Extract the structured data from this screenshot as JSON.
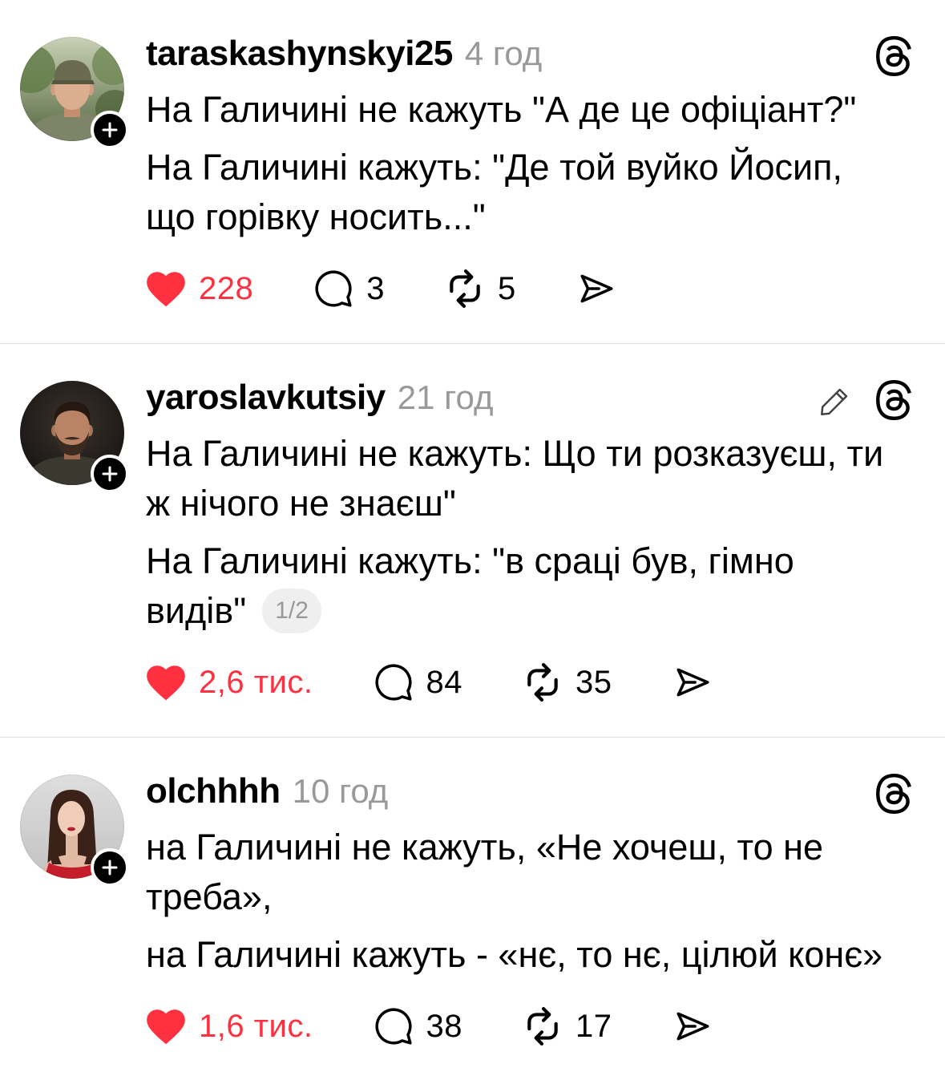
{
  "theme": {
    "accent": "#ff3040",
    "text": "#000000",
    "muted": "#999999",
    "divider": "#e1e1e1",
    "pill": "#efefef"
  },
  "icons": {
    "like": "heart-icon",
    "reply": "comment-icon",
    "repost": "repost-icon",
    "share": "send-icon",
    "app_logo": "threads-logo-icon",
    "edit": "pencil-icon",
    "follow": "plus-icon"
  },
  "posts": [
    {
      "username": "taraskashynskyi25",
      "time": "4 год",
      "text": [
        [
          "На Галичині не кажуть \"А де це офіціант?\""
        ],
        [
          "На Галичині кажуть: \"Де той вуйко Йосип,",
          "що горівку носить...\""
        ]
      ],
      "liked": true,
      "likes": "228",
      "replies": "3",
      "reposts": "5"
    },
    {
      "username": "yaroslavkutsiy",
      "time": "21 год",
      "text": [
        [
          "На Галичині не кажуть: Що ти розказуєш, ти",
          "ж нічого не знаєш\""
        ],
        [
          "На Галичині кажуть: \"в сраці був, гімно",
          "видів\""
        ]
      ],
      "page_indicator": "1/2",
      "liked": true,
      "likes": "2,6 тис.",
      "replies": "84",
      "reposts": "35"
    },
    {
      "username": "olchhhh",
      "time": "10 год",
      "text": [
        [
          "на Галичині не кажуть, «Не хочеш, то не",
          "треба»,"
        ],
        [
          "на Галичині кажуть - «нє, то нє, цілюй конє»"
        ]
      ],
      "liked": true,
      "likes": "1,6 тис.",
      "replies": "38",
      "reposts": "17"
    }
  ]
}
